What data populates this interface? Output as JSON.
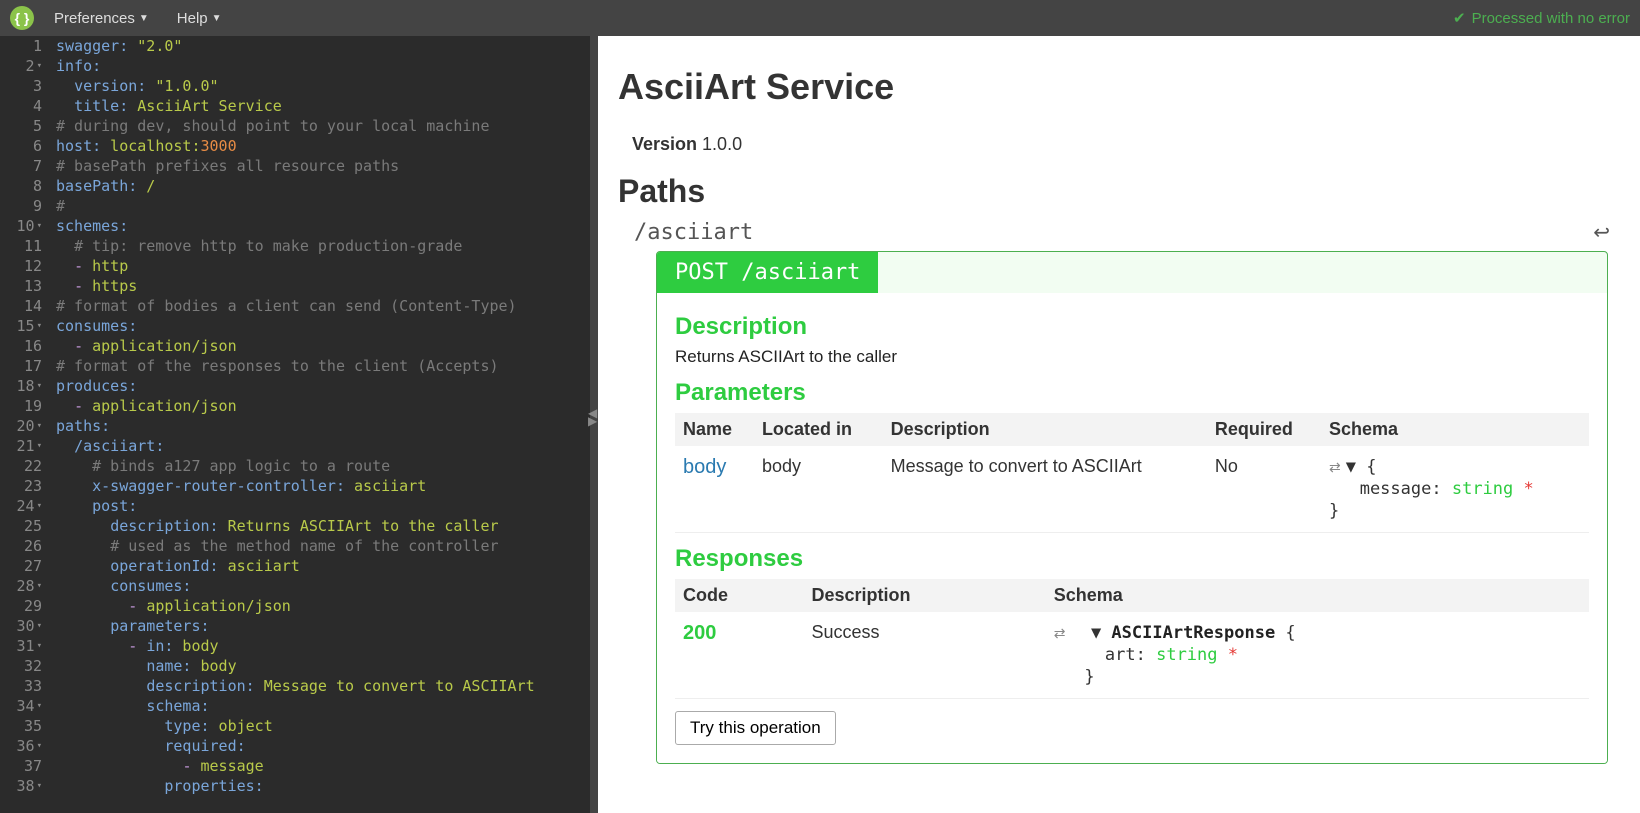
{
  "topbar": {
    "menu": {
      "preferences": "Preferences",
      "help": "Help"
    },
    "status": "Processed with no error"
  },
  "editor": {
    "lines": [
      {
        "n": 1,
        "fold": false,
        "tokens": [
          [
            "key",
            "swagger:"
          ],
          [
            "",
            ""
          ],
          [
            "str",
            " \"2.0\""
          ]
        ]
      },
      {
        "n": 2,
        "fold": true,
        "tokens": [
          [
            "key",
            "info:"
          ]
        ]
      },
      {
        "n": 3,
        "fold": false,
        "tokens": [
          [
            "",
            "  "
          ],
          [
            "key",
            "version:"
          ],
          [
            "str",
            " \"1.0.0\""
          ]
        ]
      },
      {
        "n": 4,
        "fold": false,
        "tokens": [
          [
            "",
            "  "
          ],
          [
            "key",
            "title:"
          ],
          [
            "val",
            " AsciiArt Service"
          ]
        ]
      },
      {
        "n": 5,
        "fold": false,
        "tokens": [
          [
            "cmt",
            "# during dev, should point to your local machine"
          ]
        ]
      },
      {
        "n": 6,
        "fold": false,
        "tokens": [
          [
            "key",
            "host:"
          ],
          [
            "val",
            " localhost:"
          ],
          [
            "num",
            "3000"
          ]
        ]
      },
      {
        "n": 7,
        "fold": false,
        "tokens": [
          [
            "cmt",
            "# basePath prefixes all resource paths"
          ]
        ]
      },
      {
        "n": 8,
        "fold": false,
        "tokens": [
          [
            "key",
            "basePath:"
          ],
          [
            "val",
            " /"
          ]
        ]
      },
      {
        "n": 9,
        "fold": false,
        "tokens": [
          [
            "cmt",
            "#"
          ]
        ]
      },
      {
        "n": 10,
        "fold": true,
        "tokens": [
          [
            "key",
            "schemes:"
          ]
        ]
      },
      {
        "n": 11,
        "fold": false,
        "tokens": [
          [
            "",
            "  "
          ],
          [
            "cmt",
            "# tip: remove http to make production-grade"
          ]
        ]
      },
      {
        "n": 12,
        "fold": false,
        "tokens": [
          [
            "",
            "  "
          ],
          [
            "dash",
            "- "
          ],
          [
            "val",
            "http"
          ]
        ]
      },
      {
        "n": 13,
        "fold": false,
        "tokens": [
          [
            "",
            "  "
          ],
          [
            "dash",
            "- "
          ],
          [
            "val",
            "https"
          ]
        ]
      },
      {
        "n": 14,
        "fold": false,
        "tokens": [
          [
            "cmt",
            "# format of bodies a client can send (Content-Type)"
          ]
        ]
      },
      {
        "n": 15,
        "fold": true,
        "tokens": [
          [
            "key",
            "consumes:"
          ]
        ]
      },
      {
        "n": 16,
        "fold": false,
        "tokens": [
          [
            "",
            "  "
          ],
          [
            "dash",
            "- "
          ],
          [
            "val",
            "application/json"
          ]
        ]
      },
      {
        "n": 17,
        "fold": false,
        "tokens": [
          [
            "cmt",
            "# format of the responses to the client (Accepts)"
          ]
        ]
      },
      {
        "n": 18,
        "fold": true,
        "tokens": [
          [
            "key",
            "produces:"
          ]
        ]
      },
      {
        "n": 19,
        "fold": false,
        "tokens": [
          [
            "",
            "  "
          ],
          [
            "dash",
            "- "
          ],
          [
            "val",
            "application/json"
          ]
        ]
      },
      {
        "n": 20,
        "fold": true,
        "tokens": [
          [
            "key",
            "paths:"
          ]
        ]
      },
      {
        "n": 21,
        "fold": true,
        "tokens": [
          [
            "",
            "  "
          ],
          [
            "key",
            "/asciiart:"
          ]
        ]
      },
      {
        "n": 22,
        "fold": false,
        "tokens": [
          [
            "",
            "    "
          ],
          [
            "cmt",
            "# binds a127 app logic to a route"
          ]
        ]
      },
      {
        "n": 23,
        "fold": false,
        "tokens": [
          [
            "",
            "    "
          ],
          [
            "key",
            "x-swagger-router-controller:"
          ],
          [
            "val",
            " asciiart"
          ]
        ]
      },
      {
        "n": 24,
        "fold": true,
        "tokens": [
          [
            "",
            "    "
          ],
          [
            "key",
            "post:"
          ]
        ]
      },
      {
        "n": 25,
        "fold": false,
        "tokens": [
          [
            "",
            "      "
          ],
          [
            "key",
            "description:"
          ],
          [
            "val",
            " Returns ASCIIArt to the caller"
          ]
        ]
      },
      {
        "n": 26,
        "fold": false,
        "tokens": [
          [
            "",
            "      "
          ],
          [
            "cmt",
            "# used as the method name of the controller"
          ]
        ]
      },
      {
        "n": 27,
        "fold": false,
        "tokens": [
          [
            "",
            "      "
          ],
          [
            "key",
            "operationId:"
          ],
          [
            "val",
            " asciiart"
          ]
        ]
      },
      {
        "n": 28,
        "fold": true,
        "tokens": [
          [
            "",
            "      "
          ],
          [
            "key",
            "consumes:"
          ]
        ]
      },
      {
        "n": 29,
        "fold": false,
        "tokens": [
          [
            "",
            "        "
          ],
          [
            "dash",
            "- "
          ],
          [
            "val",
            "application/json"
          ]
        ]
      },
      {
        "n": 30,
        "fold": true,
        "tokens": [
          [
            "",
            "      "
          ],
          [
            "key",
            "parameters:"
          ]
        ]
      },
      {
        "n": 31,
        "fold": true,
        "tokens": [
          [
            "",
            "        "
          ],
          [
            "dash",
            "- "
          ],
          [
            "key",
            "in:"
          ],
          [
            "val",
            " body"
          ]
        ]
      },
      {
        "n": 32,
        "fold": false,
        "tokens": [
          [
            "",
            "          "
          ],
          [
            "key",
            "name:"
          ],
          [
            "val",
            " body"
          ]
        ]
      },
      {
        "n": 33,
        "fold": false,
        "tokens": [
          [
            "",
            "          "
          ],
          [
            "key",
            "description:"
          ],
          [
            "val",
            " Message to convert to ASCIIArt"
          ]
        ]
      },
      {
        "n": 34,
        "fold": true,
        "tokens": [
          [
            "",
            "          "
          ],
          [
            "key",
            "schema:"
          ]
        ]
      },
      {
        "n": 35,
        "fold": false,
        "tokens": [
          [
            "",
            "            "
          ],
          [
            "key",
            "type:"
          ],
          [
            "val",
            " object"
          ]
        ]
      },
      {
        "n": 36,
        "fold": true,
        "tokens": [
          [
            "",
            "            "
          ],
          [
            "key",
            "required:"
          ]
        ]
      },
      {
        "n": 37,
        "fold": false,
        "tokens": [
          [
            "",
            "              "
          ],
          [
            "dash",
            "- "
          ],
          [
            "val",
            "message"
          ]
        ]
      },
      {
        "n": 38,
        "fold": true,
        "tokens": [
          [
            "",
            "            "
          ],
          [
            "key",
            "properties:"
          ]
        ]
      }
    ]
  },
  "preview": {
    "title": "AsciiArt Service",
    "version_label": "Version",
    "version": "1.0.0",
    "paths_heading": "Paths",
    "path": "/asciiart",
    "op_label": "POST /asciiart",
    "section_description": "Description",
    "description_text": "Returns ASCIIArt to the caller",
    "section_parameters": "Parameters",
    "param_headers": {
      "name": "Name",
      "in": "Located in",
      "desc": "Description",
      "req": "Required",
      "schema": "Schema"
    },
    "param_row": {
      "name": "body",
      "in": "body",
      "desc": "Message to convert to ASCIIArt",
      "req": "No",
      "schema_line1": "▼   {",
      "schema_line2_key": "message:",
      "schema_line2_type": "string",
      "schema_line3": "}"
    },
    "section_responses": "Responses",
    "resp_headers": {
      "code": "Code",
      "desc": "Description",
      "schema": "Schema"
    },
    "resp_row": {
      "code": "200",
      "desc": "Success",
      "schema_line1_pre": "▼ ",
      "schema_line1_name": "ASCIIArtResponse",
      "schema_line1_post": "  {",
      "schema_line2_key": "art:",
      "schema_line2_type": "string",
      "schema_line3": "}"
    },
    "try_button": "Try this operation"
  }
}
